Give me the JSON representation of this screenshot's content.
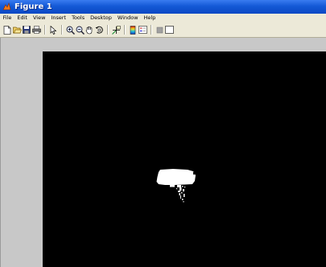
{
  "window": {
    "title": "Figure 1",
    "titlebar_color": "#1459d6"
  },
  "menu": {
    "items": [
      {
        "label": "File"
      },
      {
        "label": "Edit"
      },
      {
        "label": "View"
      },
      {
        "label": "Insert"
      },
      {
        "label": "Tools"
      },
      {
        "label": "Desktop"
      },
      {
        "label": "Window"
      },
      {
        "label": "Help"
      }
    ]
  },
  "toolbar": {
    "buttons": [
      {
        "icon": "new-figure-icon"
      },
      {
        "icon": "open-file-icon"
      },
      {
        "icon": "save-icon"
      },
      {
        "icon": "print-icon"
      },
      {
        "icon": "edit-plot-icon"
      },
      {
        "icon": "zoom-in-icon"
      },
      {
        "icon": "zoom-out-icon"
      },
      {
        "icon": "pan-icon"
      },
      {
        "icon": "rotate-3d-icon"
      },
      {
        "icon": "data-cursor-icon"
      },
      {
        "icon": "insert-colorbar-icon"
      },
      {
        "icon": "insert-legend-icon"
      },
      {
        "icon": "hide-plot-tools-icon"
      },
      {
        "icon": "show-plot-tools-icon"
      }
    ]
  },
  "figure": {
    "background_color": "#c8c8c8",
    "image_background": "#000000",
    "foreground_color": "#ffffff"
  }
}
